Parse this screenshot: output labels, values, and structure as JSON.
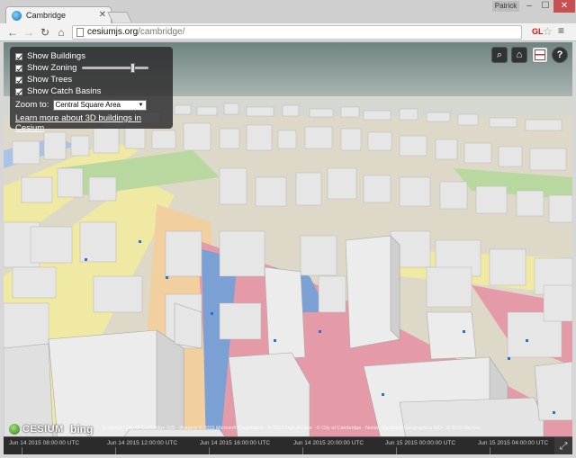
{
  "browser": {
    "tab_title": "Cambridge",
    "tab_close": "✕",
    "user": "Patrick",
    "window_min": "–",
    "window_max": "☐",
    "window_close": "✕",
    "url_host": "cesiumjs.org",
    "url_path": "/cambridge/",
    "gl_badge": "GL",
    "back": "←",
    "forward": "→",
    "reload": "↻",
    "home": "⌂",
    "star": "☆",
    "menu": "≡"
  },
  "panel": {
    "show_buildings": "Show Buildings",
    "show_zoning": "Show Zoning",
    "show_trees": "Show Trees",
    "show_catch_basins": "Show Catch Basins",
    "zoning_level": 0.78,
    "zoom_label": "Zoom to:",
    "zoom_selected": "Central Square Area",
    "learn_more": "Learn more about 3D buildings in Cesium"
  },
  "toolbar_buttons": {
    "search": "⌕",
    "home": "⌂",
    "help": "?"
  },
  "credits": {
    "cesium": "CESIUM",
    "bing": "bing",
    "attribution": "Buildings: City of Cambridge GIS · Imagery © 2015 Microsoft Corporation · © 2015 DigitalGlobe · © City of Cambridge · Nokia · Earthstar Geographics SIO · © 2015 Microsoft Corporation"
  },
  "timeline": {
    "labels": [
      "Jun 14 2015 08:00:00 UTC",
      "Jun 14 2015 12:00:00 UTC",
      "Jun 14 2015 16:00:00 UTC",
      "Jun 14 2015 20:00:00 UTC",
      "Jun 15 2015 00:00:00 UTC",
      "Jun 15 2015 04:00:00 UTC"
    ],
    "fullscreen": "⤢"
  },
  "colors": {
    "sky": "#7d8f8e",
    "zoning_pink": "#e59aa8",
    "zoning_yellow": "#efe9a3",
    "zoning_peach": "#f1cf9f",
    "road_blue": "#7ba0d4",
    "building": "#e6e6e6"
  }
}
